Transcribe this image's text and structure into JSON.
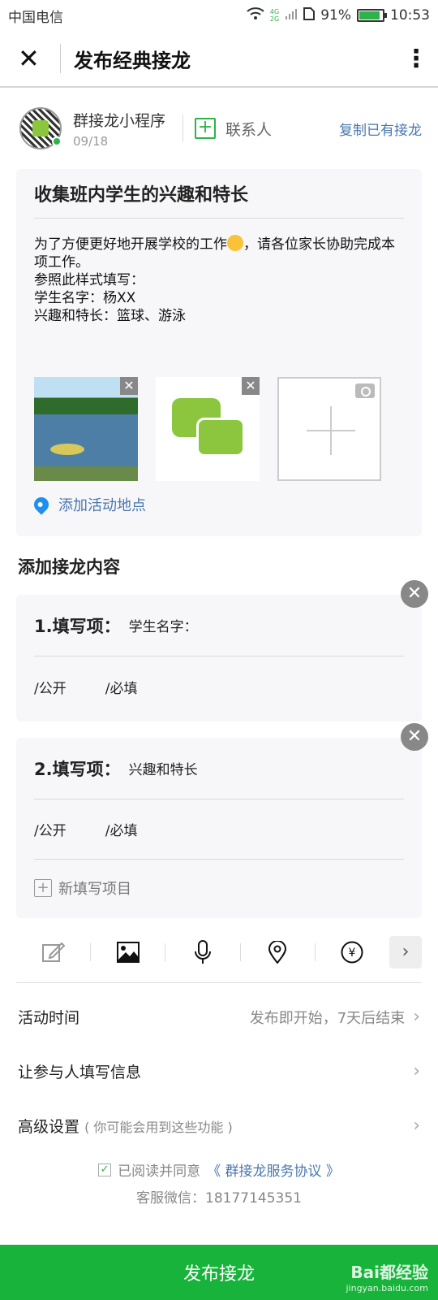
{
  "status_bar": {
    "carrier": "中国电信",
    "net_4g": "4G",
    "net_2g": "2G",
    "battery": "91%",
    "battery_level": 0.91,
    "time": "10:53"
  },
  "nav": {
    "title": "发布经典接龙"
  },
  "author": {
    "name": "群接龙小程序",
    "date": "09/18",
    "contact_label": "联系人",
    "copy_link": "复制已有接龙"
  },
  "activity": {
    "title": "收集班内学生的兴趣和特长",
    "desc_line1_a": "为了方便更好地开展学校的工作",
    "desc_line1_b": "，请各位家长协助完成本项工作。",
    "desc_line2": "参照此样式填写：",
    "desc_line3": "学生名字：杨XX",
    "desc_line4": "兴趣和特长：篮球、游泳",
    "location_label": "添加活动地点"
  },
  "section_title": "添加接龙内容",
  "items": [
    {
      "label": "1.填写项：",
      "value": "学生名字：",
      "public": "/公开",
      "required": "/必填"
    },
    {
      "label": "2.填写项：",
      "value": "兴趣和特长",
      "public": "/公开",
      "required": "/必填"
    }
  ],
  "add_item_label": "新填写项目",
  "settings": {
    "time_label": "活动时间",
    "time_value": "发布即开始，7天后结束",
    "participant_label": "让参与人填写信息",
    "advanced_label": "高级设置",
    "advanced_hint": "( 你可能会用到这些功能 )"
  },
  "agreement": {
    "text": "已阅读并同意",
    "link": "《 群接龙服务协议 》"
  },
  "service_wechat": "客服微信：18177145351",
  "publish_label": "发布接龙",
  "watermark": {
    "logo": "Bai都经验",
    "url": "jingyan.baidu.com"
  },
  "colors": {
    "accent": "#17b33a",
    "link": "#4a77ad"
  }
}
